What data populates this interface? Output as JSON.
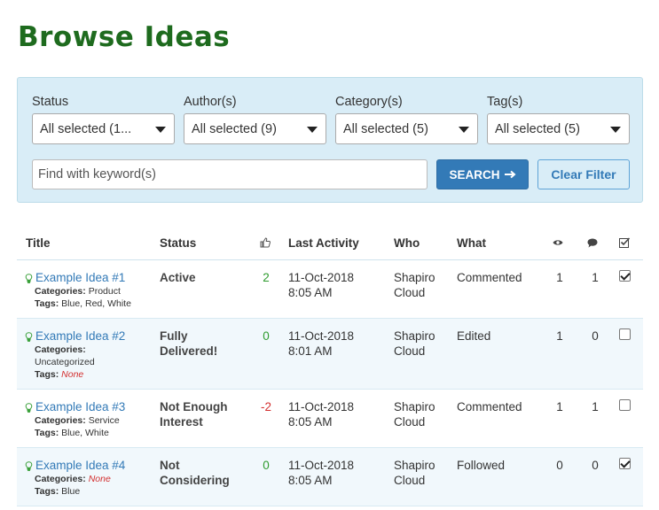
{
  "page": {
    "title": "Browse Ideas"
  },
  "filters": {
    "status": {
      "label": "Status",
      "value": "All selected (1..."
    },
    "author": {
      "label": "Author(s)",
      "value": "All selected (9)"
    },
    "category": {
      "label": "Category(s)",
      "value": "All selected (5)"
    },
    "tag": {
      "label": "Tag(s)",
      "value": "All selected (5)"
    },
    "keyword": {
      "placeholder": "Find with keyword(s)",
      "value": ""
    },
    "search_label": "SEARCH",
    "clear_label": "Clear Filter"
  },
  "table": {
    "headers": {
      "title": "Title",
      "status": "Status",
      "last_activity": "Last Activity",
      "who": "Who",
      "what": "What"
    },
    "labels": {
      "categories": "Categories:",
      "tags": "Tags:"
    },
    "rows": [
      {
        "title": "Example Idea #1",
        "categories": "Product",
        "tags": "Blue, Red, White",
        "status_1": "Active",
        "status_2": "",
        "votes": "2",
        "date": "11-Oct-2018",
        "time": "8:05 AM",
        "who_1": "Shapiro",
        "who_2": "Cloud",
        "what": "Commented",
        "views": "1",
        "comments": "1",
        "checked": true
      },
      {
        "title": "Example Idea #2",
        "categories": "Uncategorized",
        "tags": "None",
        "status_1": "Fully",
        "status_2": "Delivered!",
        "votes": "0",
        "date": "11-Oct-2018",
        "time": "8:01 AM",
        "who_1": "Shapiro",
        "who_2": "Cloud",
        "what": "Edited",
        "views": "1",
        "comments": "0",
        "checked": false
      },
      {
        "title": "Example Idea #3",
        "categories": "Service",
        "tags": "Blue, White",
        "status_1": "Not Enough",
        "status_2": "Interest",
        "votes": "-2",
        "date": "11-Oct-2018",
        "time": "8:05 AM",
        "who_1": "Shapiro",
        "who_2": "Cloud",
        "what": "Commented",
        "views": "1",
        "comments": "1",
        "checked": false
      },
      {
        "title": "Example Idea #4",
        "categories": "None",
        "tags": "Blue",
        "status_1": "Not",
        "status_2": "Considering",
        "votes": "0",
        "date": "11-Oct-2018",
        "time": "8:05 AM",
        "who_1": "Shapiro",
        "who_2": "Cloud",
        "what": "Followed",
        "views": "0",
        "comments": "0",
        "checked": true
      }
    ]
  },
  "colors": {
    "title_green": "#1e6b1e",
    "panel_bg": "#d9edf7",
    "primary_blue": "#337ab7",
    "positive_green": "#2e9b2e",
    "negative_red": "#d32f2f"
  },
  "icons": [
    "thumbs-up-icon",
    "eye-icon",
    "comment-icon",
    "check-square-icon",
    "lightbulb-icon",
    "arrow-right-icon",
    "caret-down-icon"
  ]
}
